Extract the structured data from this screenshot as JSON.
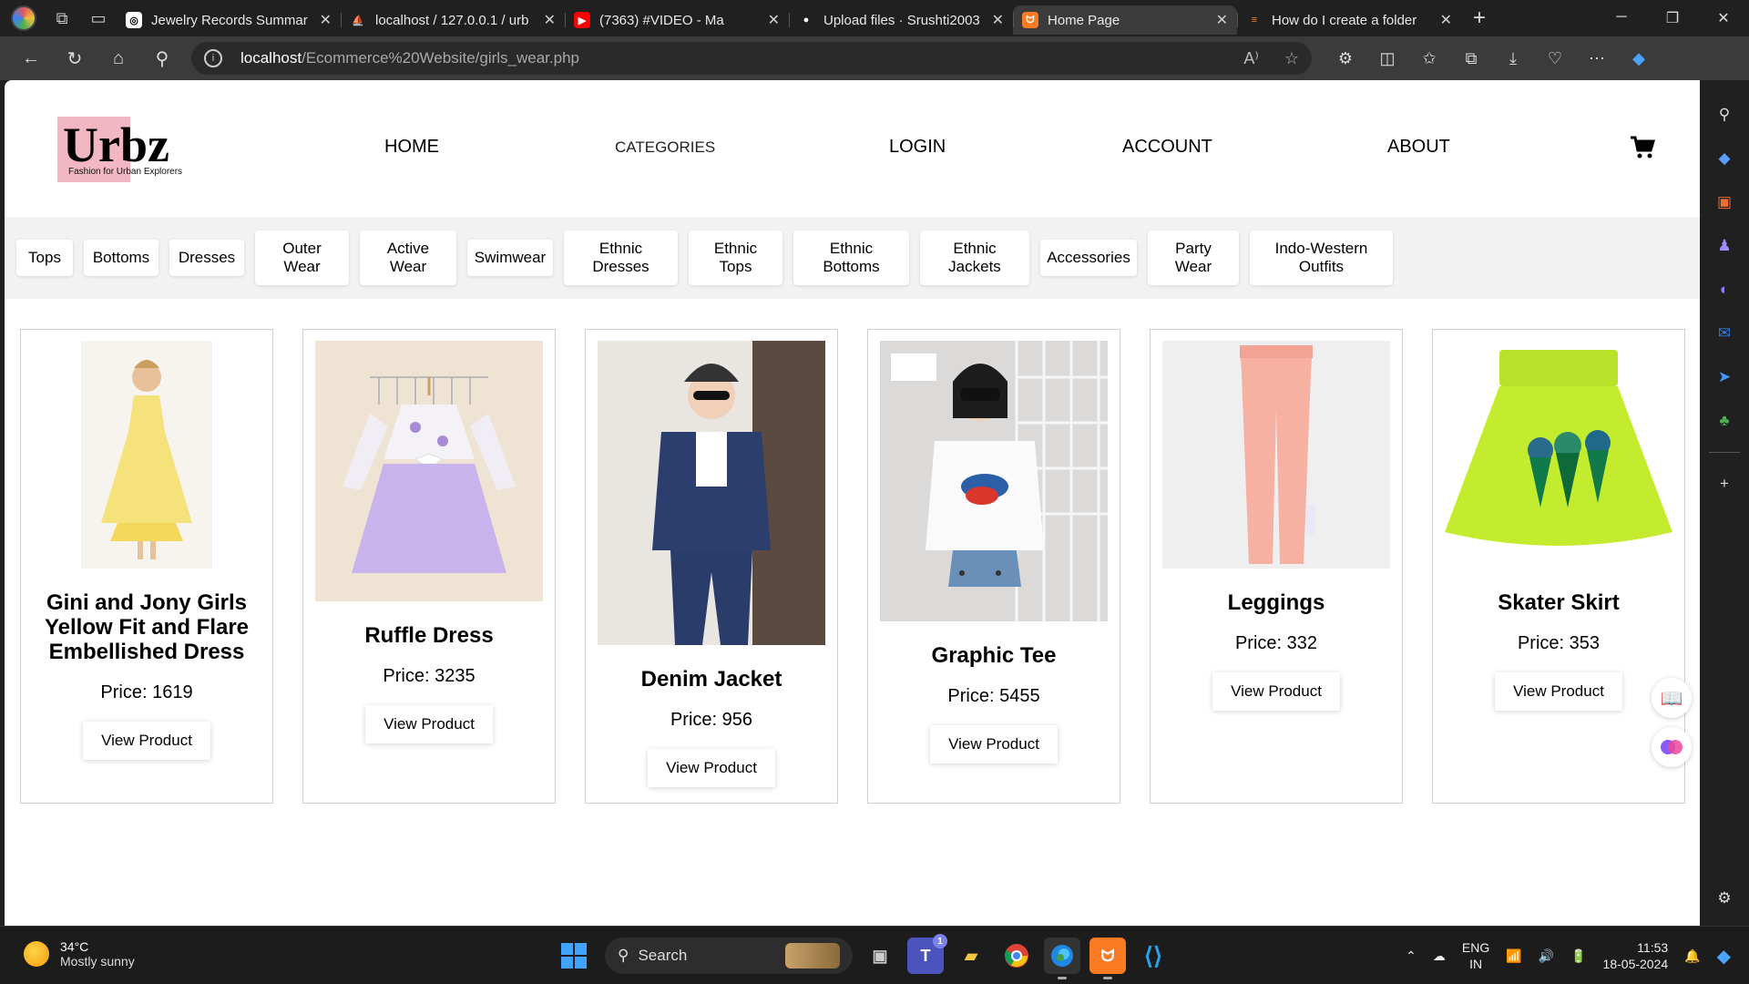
{
  "browser": {
    "tabs": [
      {
        "title": "Jewelry Records Summar",
        "fav_bg": "#ffffff",
        "fav_fg": "#000000",
        "fav_glyph": "◎",
        "active": false
      },
      {
        "title": "localhost / 127.0.0.1 / urb",
        "fav_bg": "#202020",
        "fav_fg": "#f0a030",
        "fav_glyph": "⛵",
        "active": false
      },
      {
        "title": "(7363) #VIDEO - Ma",
        "fav_bg": "#ff0000",
        "fav_fg": "#ffffff",
        "fav_glyph": "▶",
        "active": false
      },
      {
        "title": "Upload files · Srushti2003",
        "fav_bg": "#202020",
        "fav_fg": "#ffffff",
        "fav_glyph": "●",
        "active": false
      },
      {
        "title": "Home Page",
        "fav_bg": "#fb7a24",
        "fav_fg": "#ffffff",
        "fav_glyph": "ᗢ",
        "active": true
      },
      {
        "title": "How do I create a folder",
        "fav_bg": "#202020",
        "fav_fg": "#f48024",
        "fav_glyph": "≡",
        "active": false
      }
    ],
    "url_host": "localhost",
    "url_path": "/Ecommerce%20Website/girls_wear.php"
  },
  "site": {
    "logo_text": "Urbz",
    "logo_tagline": "Fashion for Urban Explorers",
    "logo_accent": "#f3b7c3",
    "nav": {
      "home": "HOME",
      "categories": "CATEGORIES",
      "login": "LOGIN",
      "account": "ACCOUNT",
      "about": "ABOUT"
    },
    "categories": [
      {
        "label": "Tops",
        "two_line": false
      },
      {
        "label": "Bottoms",
        "two_line": false
      },
      {
        "label": "Dresses",
        "two_line": false
      },
      {
        "label": "Outer\nWear",
        "two_line": true
      },
      {
        "label": "Active\nWear",
        "two_line": true
      },
      {
        "label": "Swimwear",
        "two_line": false
      },
      {
        "label": "Ethnic\nDresses",
        "two_line": true
      },
      {
        "label": "Ethnic\nTops",
        "two_line": true
      },
      {
        "label": "Ethnic\nBottoms",
        "two_line": true
      },
      {
        "label": "Ethnic\nJackets",
        "two_line": true
      },
      {
        "label": "Accessories",
        "two_line": false
      },
      {
        "label": "Party\nWear",
        "two_line": true
      },
      {
        "label": "Indo-Western\nOutfits",
        "two_line": true
      }
    ],
    "products": [
      {
        "name": "Gini and Jony Girls Yellow Fit and Flare Embellished Dress",
        "price": "Price: 1619",
        "button": "View Product",
        "image": "yellow-dress"
      },
      {
        "name": "Ruffle Dress",
        "price": "Price: 3235",
        "button": "View Product",
        "image": "lavender-ruffle-dress"
      },
      {
        "name": "Denim Jacket",
        "price": "Price: 956",
        "button": "View Product",
        "image": "denim-jacket"
      },
      {
        "name": "Graphic Tee",
        "price": "Price: 5455",
        "button": "View Product",
        "image": "graphic-tee"
      },
      {
        "name": "Leggings",
        "price": "Price: 332",
        "button": "View Product",
        "image": "pink-leggings"
      },
      {
        "name": "Skater Skirt",
        "price": "Price: 353",
        "button": "View Product",
        "image": "lime-skater-skirt"
      }
    ]
  },
  "taskbar": {
    "weather_temp": "34°C",
    "weather_desc": "Mostly sunny",
    "search_label": "Search",
    "lang_line1": "ENG",
    "lang_line2": "IN",
    "time": "11:53",
    "date": "18-05-2024",
    "teams_badge": "1"
  }
}
